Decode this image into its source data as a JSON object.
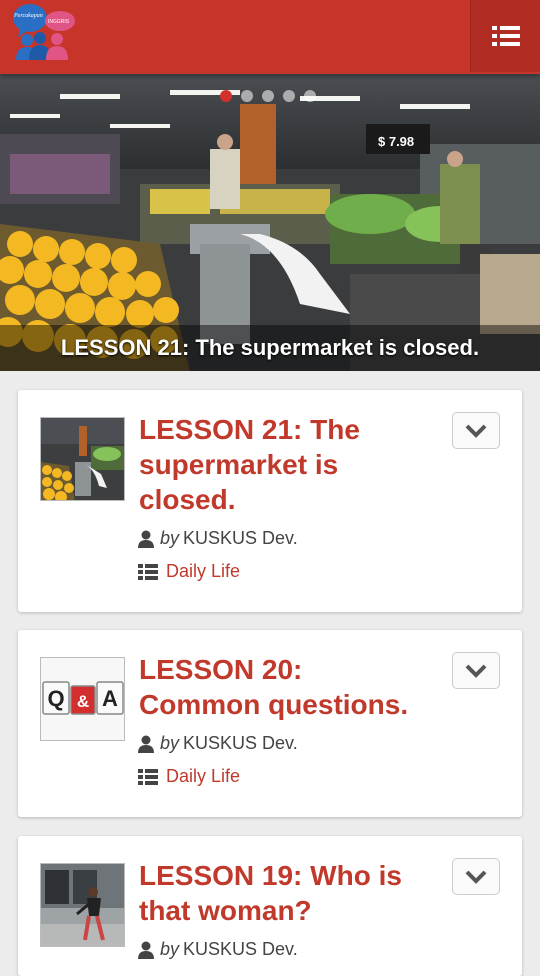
{
  "header": {
    "logo_text_left": "Percakapan",
    "logo_text_right": "INGGRIS",
    "menu_icon": "list-menu-icon",
    "accent": "#c7352a"
  },
  "slider": {
    "caption": "LESSON 21: The supermarket is closed.",
    "dot_count": 5,
    "active_dot": 0,
    "price_sign": "$ 7.98"
  },
  "lessons": [
    {
      "title": "LESSON 21: The supermarket is closed.",
      "by": "by",
      "author": "KUSKUS Dev.",
      "category": "Daily Life"
    },
    {
      "title": "LESSON 20: Common questions.",
      "by": "by",
      "author": "KUSKUS Dev.",
      "category": "Daily Life",
      "thumb_letters": [
        "Q",
        "&",
        "A"
      ]
    },
    {
      "title": "LESSON 19: Who is that woman?",
      "by": "by",
      "author": "KUSKUS Dev."
    }
  ]
}
